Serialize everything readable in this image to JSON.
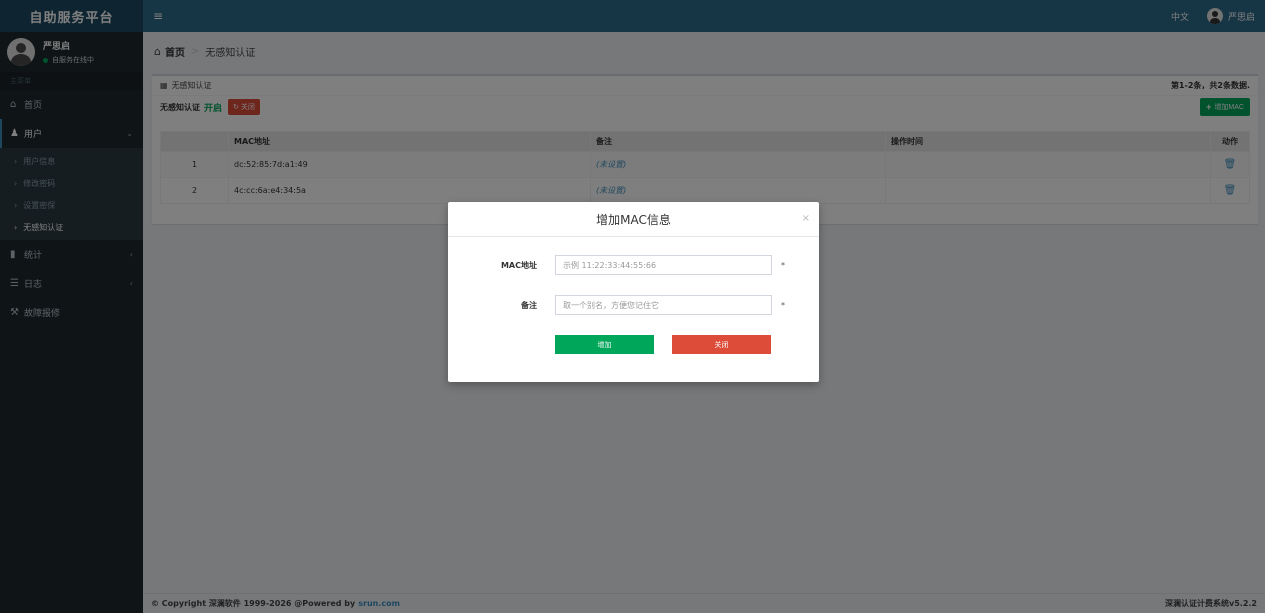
{
  "header": {
    "logo": "自助服务平台",
    "menu_icon": "hamburger-icon",
    "language": "中文",
    "username": "严思启"
  },
  "sidebar": {
    "user": {
      "name": "严思启",
      "status": "自服务在线中"
    },
    "section": "主菜单",
    "items": [
      {
        "label": "首页",
        "icon": "home-icon"
      },
      {
        "label": "用户",
        "icon": "user-icon",
        "sub": [
          "用户信息",
          "修改密码",
          "设置密保",
          "无感知认证"
        ]
      },
      {
        "label": "统计",
        "icon": "bar-chart-icon"
      },
      {
        "label": "日志",
        "icon": "list-icon"
      },
      {
        "label": "故障报修",
        "icon": "wrench-icon"
      }
    ]
  },
  "breadcrumb": {
    "home": "首页",
    "current": "无感知认证"
  },
  "box": {
    "title": "无感知认证",
    "summary": "第1-2条，共2条数据.",
    "toolbar": {
      "label": "无感知认证",
      "state": "开启",
      "off_button": "关闭",
      "add_button": "增加MAC"
    }
  },
  "table": {
    "headers": [
      "",
      "MAC地址",
      "备注",
      "操作时间",
      "动作"
    ],
    "rows": [
      {
        "idx": "1",
        "mac": "dc:52:85:7d:a1:49",
        "note": "(未设置)",
        "time": ""
      },
      {
        "idx": "2",
        "mac": "4c:cc:6a:e4:34:5a",
        "note": "(未设置)",
        "time": ""
      }
    ]
  },
  "footer": {
    "copyright": "© Copyright 深澜软件 1999-2026 @Powered by",
    "link": "srun.com",
    "version": "深澜认证计费系统v5.2.2"
  },
  "modal": {
    "title": "增加MAC信息",
    "close": "×",
    "mac_label": "MAC地址",
    "mac_placeholder": "示例 11:22:33:44:55:66",
    "note_label": "备注",
    "note_placeholder": "取一个别名，方便您记住它",
    "required": "*",
    "submit": "增加",
    "cancel": "关闭"
  },
  "colors": {
    "success": "#00a65a",
    "danger": "#dd4b39",
    "link": "#3c8dbc",
    "header": "#2c6a8a",
    "sidebar": "#1f2a2f"
  }
}
